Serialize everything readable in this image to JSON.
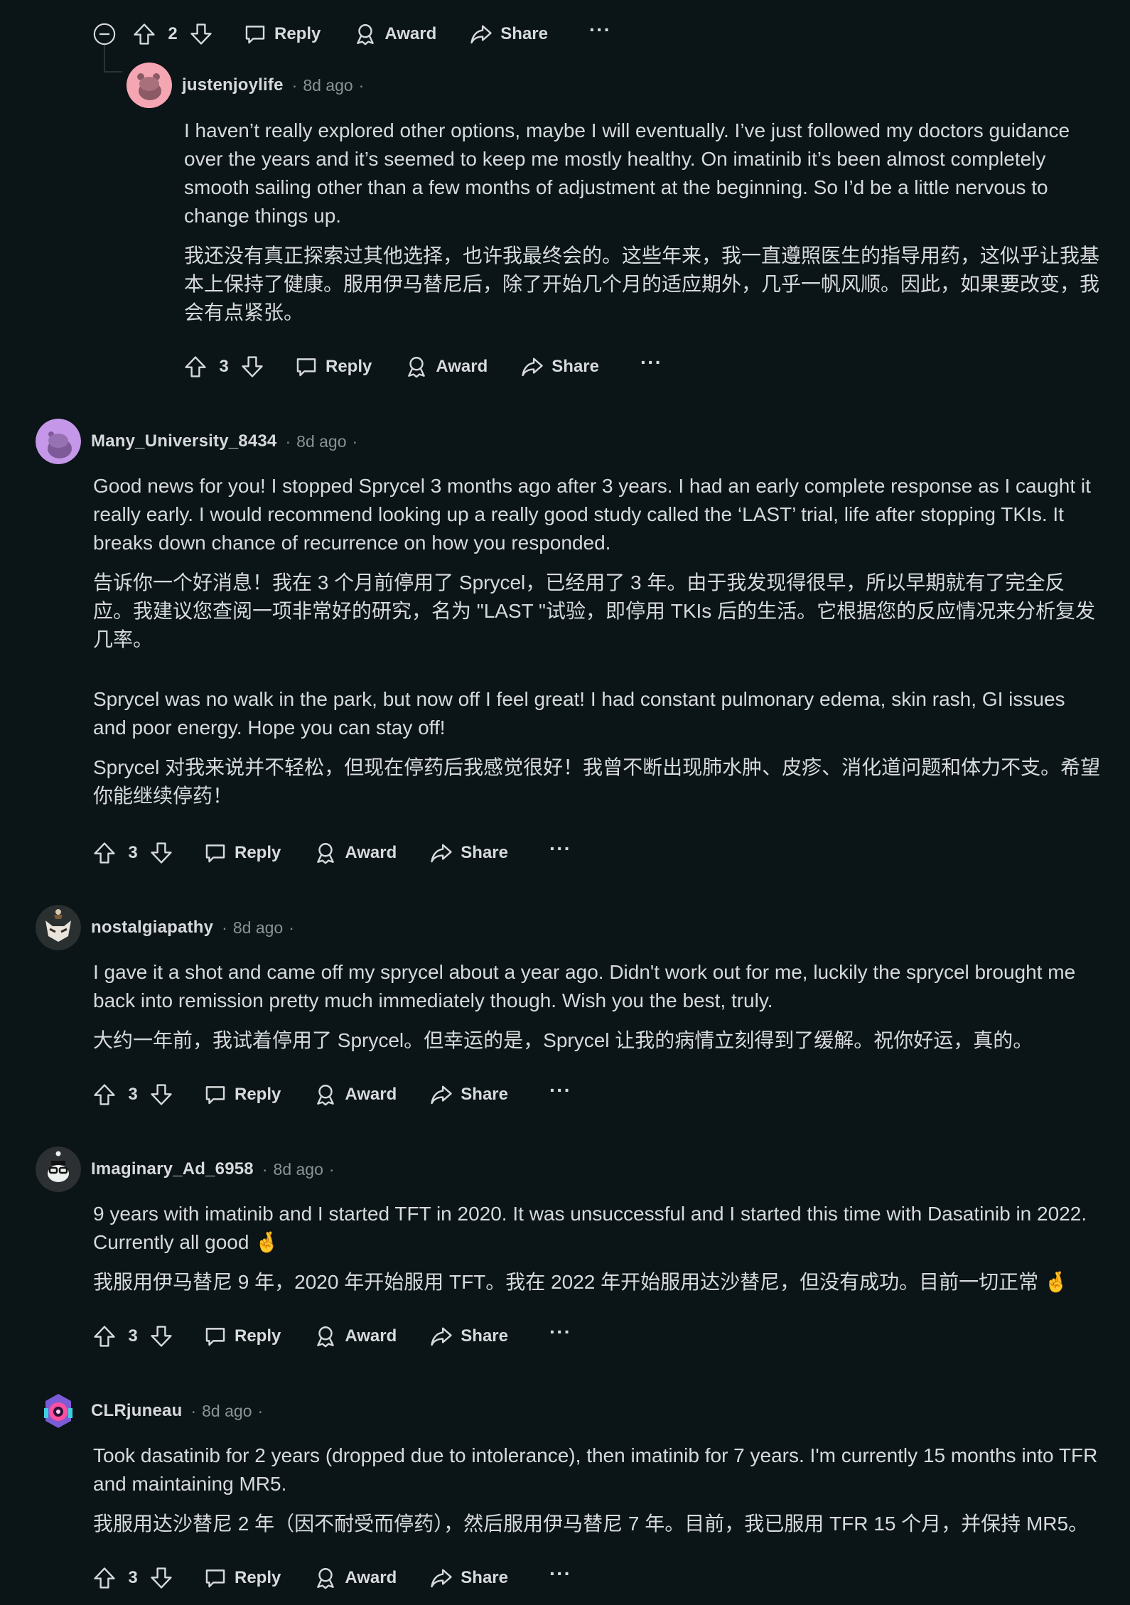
{
  "colors": {
    "background": "#0b1416",
    "text": "#d7dadc",
    "meta": "#8a9296",
    "thread_line": "#2a3236"
  },
  "actions": {
    "reply": "Reply",
    "award": "Award",
    "share": "Share",
    "more": "···"
  },
  "top_bar": {
    "votes": "2"
  },
  "comments": [
    {
      "username": "justenjoylife",
      "time": "8d ago",
      "en": "I haven’t really explored other options, maybe I will eventually. I’ve just followed my doctors guidance over the years and it’s seemed to keep me mostly healthy. On imatinib it’s been almost completely smooth sailing other than a few months of adjustment at the beginning. So I’d be a little nervous to change things up.",
      "zh": "我还没有真正探索过其他选择，也许我最终会的。这些年来，我一直遵照医生的指导用药，这似乎让我基本上保持了健康。服用伊马替尼后，除了开始几个月的适应期外，几乎一帆风顺。因此，如果要改变，我会有点紧张。",
      "votes": "3",
      "avatar": "pink-snoo-avatar"
    },
    {
      "username": "Many_University_8434",
      "time": "8d ago",
      "en": "Good news for you! I stopped Sprycel 3 months ago after 3 years. I had an early complete response as I caught it really early. I would recommend looking up a really good study called the ‘LAST’ trial, life after stopping TKIs. It breaks down chance of recurrence on how you responded.",
      "zh": "告诉你一个好消息！我在 3 个月前停用了 Sprycel，已经用了 3 年。由于我发现得很早，所以早期就有了完全反应。我建议您查阅一项非常好的研究，名为 \"LAST \"试验，即停用 TKIs 后的生活。它根据您的反应情况来分析复发几率。",
      "en2": "Sprycel was no walk in the park, but now off I feel great! I had constant pulmonary edema, skin rash, GI issues and poor energy. Hope you can stay off!",
      "zh2": "Sprycel 对我来说并不轻松，但现在停药后我感觉很好！我曾不断出现肺水肿、皮疹、消化道问题和体力不支。希望你能继续停药！",
      "votes": "3",
      "avatar": "purple-snoo-avatar"
    },
    {
      "username": "nostalgiapathy",
      "time": "8d ago",
      "en": "I gave it a shot and came off my sprycel about a year ago. Didn't work out for me, luckily the sprycel brought me back into remission pretty much immediately though. Wish you the best, truly.",
      "zh": "大约一年前，我试着停用了 Sprycel。但幸运的是，Sprycel 让我的病情立刻得到了缓解。祝你好运，真的。",
      "votes": "3",
      "avatar": "fox-snoo-avatar"
    },
    {
      "username": "Imaginary_Ad_6958",
      "time": "8d ago",
      "en": "9 years with imatinib and I started TFT in 2020. It was unsuccessful and I started this time with Dasatinib in 2022. Currently all good 🤞",
      "zh": "我服用伊马替尼 9 年，2020 年开始服用 TFT。我在 2022 年开始服用达沙替尼，但没有成功。目前一切正常 🤞",
      "votes": "3",
      "avatar": "glasses-snoo-avatar"
    },
    {
      "username": "CLRjuneau",
      "time": "8d ago",
      "en": "Took dasatinib for 2 years (dropped due to intolerance), then imatinib for 7 years. I'm currently 15 months into TFR and maintaining MR5.",
      "zh": "我服用达沙替尼 2 年（因不耐受而停药），然后服用伊马替尼 7 年。目前，我已服用 TFR 15 个月，并保持 MR5。",
      "votes": "3",
      "avatar": "robot-snoo-avatar"
    }
  ]
}
